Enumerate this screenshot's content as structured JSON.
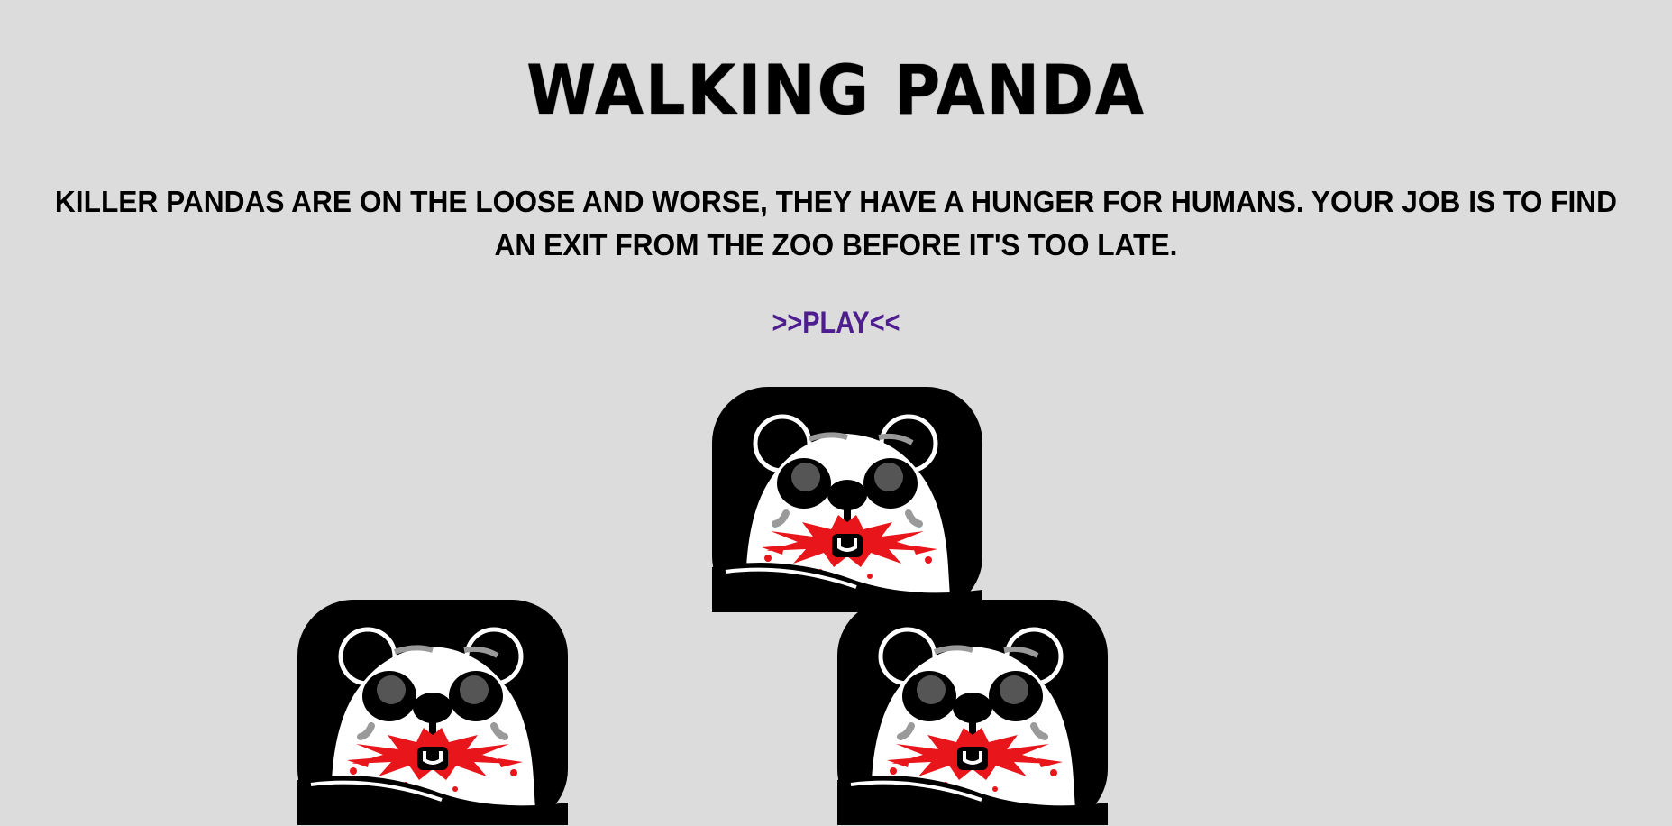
{
  "game": {
    "title": "WALKING PANDA",
    "intro": "KILLER PANDAS ARE ON THE LOOSE AND WORSE, THEY HAVE A HUNGER FOR HUMANS. YOUR JOB IS TO FIND AN EXIT FROM THE ZOO BEFORE IT'S TOO LATE.",
    "play_label": ">>PLAY<<"
  },
  "colors": {
    "background": "#dcdcdc",
    "text": "#000000",
    "play_link": "#4e1d8f",
    "blood": "#e8151b"
  },
  "pandas": [
    {
      "name": "killer-panda-top",
      "icon": "killer-panda-icon"
    },
    {
      "name": "killer-panda-left",
      "icon": "killer-panda-icon"
    },
    {
      "name": "killer-panda-right",
      "icon": "killer-panda-icon"
    }
  ]
}
